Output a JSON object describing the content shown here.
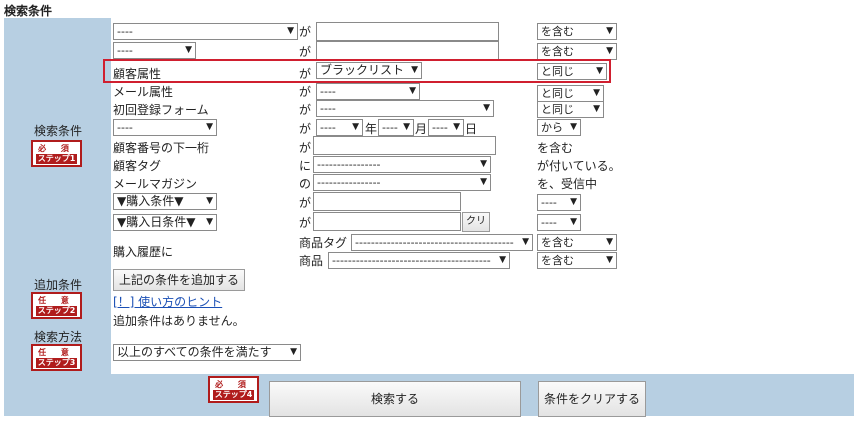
{
  "title": "検索条件",
  "side": {
    "search_conditions": "検索条件",
    "additional_conditions": "追加条件",
    "search_method": "検索方法",
    "step1": {
      "top": "必 須",
      "bottom": "ステップ1"
    },
    "step2": {
      "top": "任 意",
      "bottom": "ステップ2"
    },
    "step3": {
      "top": "任 意",
      "bottom": "ステップ3"
    },
    "step4": {
      "top": "必 須",
      "bottom": "ステップ4"
    }
  },
  "rows": {
    "r1": {
      "field": "----",
      "particle": "が",
      "value": "",
      "op": "を含む"
    },
    "r2": {
      "field": "----",
      "particle": "が",
      "value": "",
      "op": "を含む"
    },
    "r3": {
      "label": "顧客属性",
      "particle": "が",
      "value": "ブラックリスト",
      "op": "と同じ"
    },
    "r4": {
      "label": "メール属性",
      "particle": "が",
      "value": "----",
      "op": "と同じ"
    },
    "r5": {
      "label": "初回登録フォーム",
      "particle": "が",
      "value": "----",
      "op": "と同じ"
    },
    "r6": {
      "field": "----",
      "particle": "が",
      "year_sel": "----",
      "year": "年",
      "month_sel": "----",
      "month": "月",
      "day_sel": "----",
      "day": "日",
      "op": "から"
    },
    "r7": {
      "label": "顧客番号の下一桁",
      "particle": "が",
      "value": "",
      "op": "を含む"
    },
    "r8": {
      "label": "顧客タグ",
      "particle": "に",
      "value": "----------------",
      "op": "が付いている。"
    },
    "r9": {
      "label": "メールマガジン",
      "particle": "の",
      "value": "----------------",
      "op": "を、受信中"
    },
    "r10": {
      "field": "▼購入条件▼",
      "particle": "が",
      "value": "",
      "op": "----"
    },
    "r11": {
      "field": "▼購入日条件▼",
      "particle": "が",
      "value": "",
      "clear": "クリ",
      "op": "----"
    },
    "r12": {
      "label": "購入履歴に",
      "tag_label": "商品タグ",
      "tag_value": "----------------------------------------",
      "tag_op": "を含む",
      "product_label": "商品",
      "product_value": "----------------------------------------",
      "product_op": "を含む"
    }
  },
  "add_button": "上記の条件を追加する",
  "hint_link": "[！] 使い方のヒント",
  "no_additional": "追加条件はありません。",
  "method_value": "以上のすべての条件を満たす",
  "search_button": "検索する",
  "clear_button": "条件をクリアする",
  "colors": {
    "panel": "#b7cfe2",
    "badge": "#b01c1c",
    "highlight": "#d01f2f",
    "link": "#1a4fb5"
  }
}
